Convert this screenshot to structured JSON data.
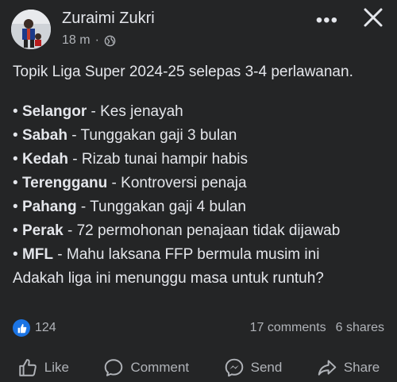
{
  "post": {
    "author": "Zuraimi Zukri",
    "time": "18 m",
    "intro": "Topik Liga Super 2024-25 selepas 3-4 perlawanan.",
    "items": [
      {
        "team": "Selangor",
        "issue": " - Kes jenayah"
      },
      {
        "team": "Sabah",
        "issue": " - Tunggakan gaji 3 bulan"
      },
      {
        "team": "Kedah",
        "issue": " - Rizab tunai hampir habis"
      },
      {
        "team": "Terengganu",
        "issue": " - Kontroversi penaja"
      },
      {
        "team": "Pahang",
        "issue": " - Tunggakan gaji 4 bulan"
      },
      {
        "team": "Perak",
        "issue": " - 72 permohonan penajaan tidak dijawab"
      },
      {
        "team": "MFL",
        "issue": " - Mahu laksana FFP bermula musim ini"
      }
    ],
    "closing": "Adakah liga ini menunggu masa untuk runtuh?"
  },
  "engagement": {
    "reaction_count": "124",
    "comments": "17 comments",
    "shares": "6 shares"
  },
  "actions": {
    "like": "Like",
    "comment": "Comment",
    "send": "Send",
    "share": "Share"
  },
  "colors": {
    "background": "#242526",
    "text": "#e4e6eb",
    "muted": "#b0b3b8",
    "accent": "#1b74e4"
  }
}
